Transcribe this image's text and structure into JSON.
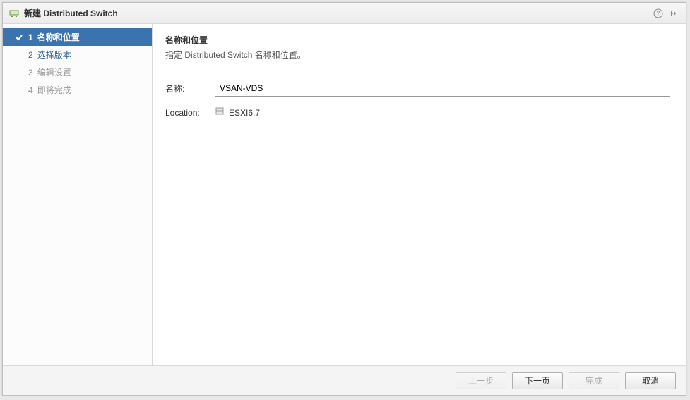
{
  "titlebar": {
    "title": "新建 Distributed Switch"
  },
  "steps": [
    {
      "num": "1",
      "label": "名称和位置",
      "state": "active"
    },
    {
      "num": "2",
      "label": "选择版本",
      "state": "next"
    },
    {
      "num": "3",
      "label": "编辑设置",
      "state": "future"
    },
    {
      "num": "4",
      "label": "即将完成",
      "state": "future"
    }
  ],
  "content": {
    "heading": "名称和位置",
    "subheading": "指定 Distributed Switch 名称和位置。",
    "name_label": "名称:",
    "name_value": "VSAN-VDS",
    "location_label": "Location:",
    "location_value": "ESXI6.7"
  },
  "footer": {
    "back": "上一步",
    "next": "下一页",
    "finish": "完成",
    "cancel": "取消"
  }
}
